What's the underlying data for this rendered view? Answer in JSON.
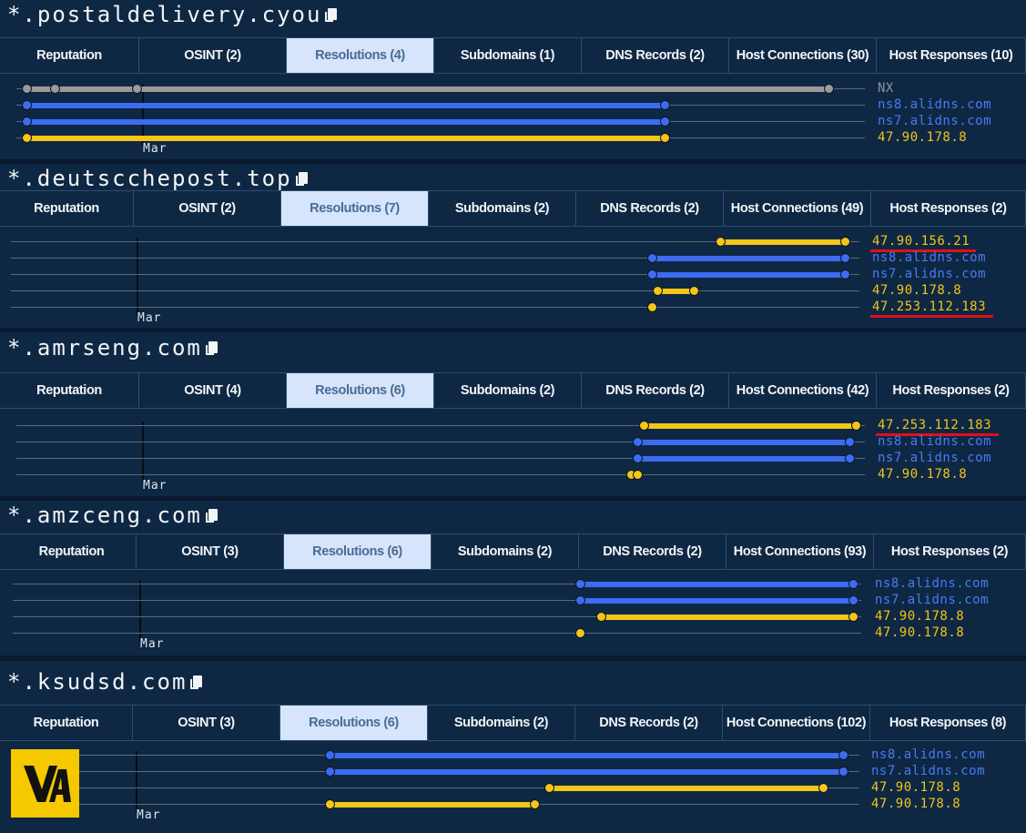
{
  "colors": {
    "blue": "#3d6cf0",
    "yellow": "#f5c518",
    "gray": "#9a9a9a"
  },
  "legend_colors": {
    "blue": "#4a79f4",
    "yellow": "#f2c518",
    "gray": "#8a93a0"
  },
  "month_label": "Mar",
  "logo": {
    "text": "VA"
  },
  "panels": [
    {
      "domain": "*.postaldelivery.cyou",
      "tabs": [
        "Reputation",
        "OSINT (2)",
        "Resolutions (4)",
        "Subdomains (1)",
        "DNS Records (2)",
        "Host Connections (30)",
        "Host Responses (10)"
      ],
      "active_tab": 2,
      "resolutions": [
        {
          "label": "NX",
          "color": "gray"
        },
        {
          "label": "ns8.alidns.com",
          "color": "blue"
        },
        {
          "label": "ns7.alidns.com",
          "color": "blue"
        },
        {
          "label": "47.90.178.8",
          "color": "yellow"
        }
      ]
    },
    {
      "domain": "*.deutscchepost.top",
      "tabs": [
        "Reputation",
        "OSINT (2)",
        "Resolutions (7)",
        "Subdomains (2)",
        "DNS Records (2)",
        "Host Connections (49)",
        "Host Responses (2)"
      ],
      "active_tab": 2,
      "resolutions": [
        {
          "label": "47.90.156.21",
          "color": "yellow",
          "highlighted": true
        },
        {
          "label": "ns8.alidns.com",
          "color": "blue"
        },
        {
          "label": "ns7.alidns.com",
          "color": "blue"
        },
        {
          "label": "47.90.178.8",
          "color": "yellow"
        },
        {
          "label": "47.253.112.183",
          "color": "yellow",
          "highlighted": true
        }
      ]
    },
    {
      "domain": "*.amrseng.com",
      "tabs": [
        "Reputation",
        "OSINT (4)",
        "Resolutions (6)",
        "Subdomains (2)",
        "DNS Records (2)",
        "Host Connections (42)",
        "Host Responses (2)"
      ],
      "active_tab": 2,
      "resolutions": [
        {
          "label": "47.253.112.183",
          "color": "yellow",
          "highlighted": true
        },
        {
          "label": "ns8.alidns.com",
          "color": "blue"
        },
        {
          "label": "ns7.alidns.com",
          "color": "blue"
        },
        {
          "label": "47.90.178.8",
          "color": "yellow"
        }
      ]
    },
    {
      "domain": "*.amzceng.com",
      "tabs": [
        "Reputation",
        "OSINT (3)",
        "Resolutions (6)",
        "Subdomains (2)",
        "DNS Records (2)",
        "Host Connections (93)",
        "Host Responses (2)"
      ],
      "active_tab": 2,
      "resolutions": [
        {
          "label": "ns8.alidns.com",
          "color": "blue"
        },
        {
          "label": "ns7.alidns.com",
          "color": "blue"
        },
        {
          "label": "47.90.178.8",
          "color": "yellow"
        },
        {
          "label": "47.90.178.8",
          "color": "yellow"
        }
      ]
    },
    {
      "domain": "*.ksudsd.com",
      "tabs": [
        "Reputation",
        "OSINT (3)",
        "Resolutions (6)",
        "Subdomains (2)",
        "DNS Records (2)",
        "Host Connections (102)",
        "Host Responses (8)"
      ],
      "active_tab": 2,
      "resolutions": [
        {
          "label": "ns8.alidns.com",
          "color": "blue"
        },
        {
          "label": "ns7.alidns.com",
          "color": "blue"
        },
        {
          "label": "47.90.178.8",
          "color": "yellow"
        },
        {
          "label": "47.90.178.8",
          "color": "yellow"
        }
      ]
    }
  ]
}
